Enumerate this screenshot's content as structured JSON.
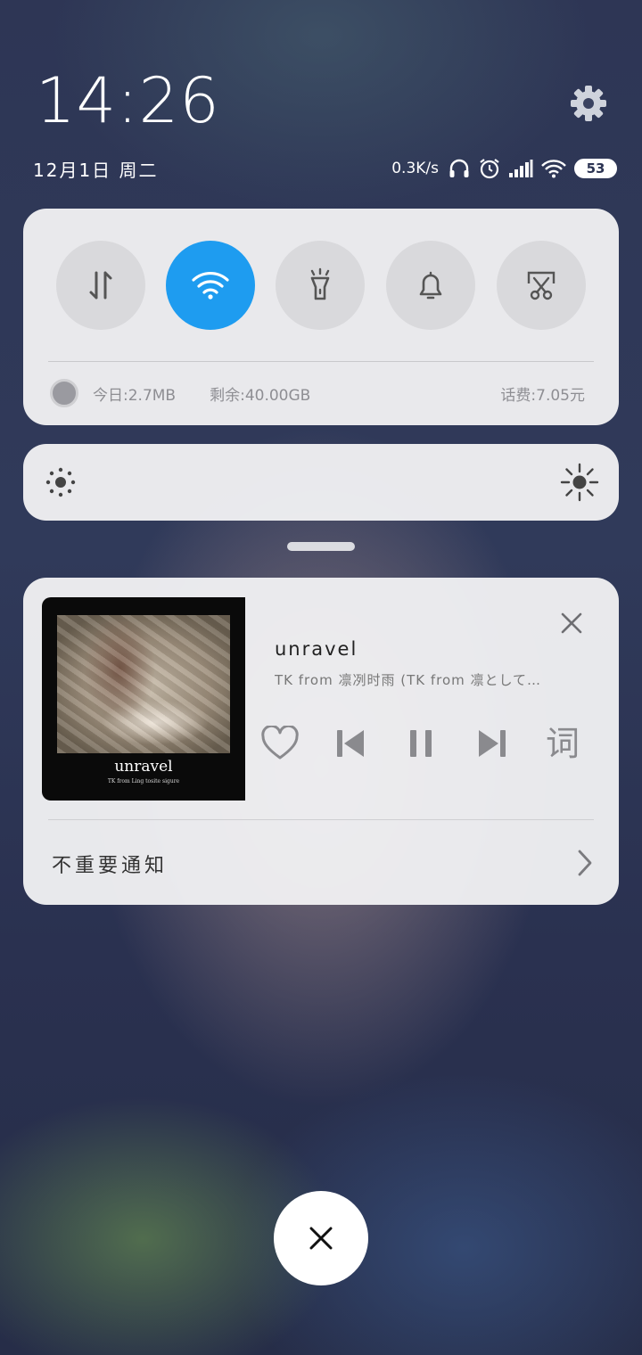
{
  "status": {
    "time": "14:26",
    "date": "12月1日 周二",
    "net_speed": "0.3K/s",
    "battery": "53",
    "icons": [
      "headphones-icon",
      "alarm-icon",
      "signal-icon",
      "wifi-icon",
      "battery-icon"
    ]
  },
  "quick_settings": {
    "toggles": [
      {
        "name": "mobile-data",
        "icon": "data-arrows-icon",
        "active": false
      },
      {
        "name": "wifi",
        "icon": "wifi-icon",
        "active": true
      },
      {
        "name": "flashlight",
        "icon": "flashlight-icon",
        "active": false
      },
      {
        "name": "sound",
        "icon": "bell-icon",
        "active": false
      },
      {
        "name": "screenshot",
        "icon": "scissors-icon",
        "active": false
      }
    ],
    "data_today": "今日:2.7MB",
    "data_remaining": "剩余:40.00GB",
    "phone_fee": "话费:7.05元"
  },
  "music": {
    "album_title": "unravel",
    "album_subtitle": "TK from Ling tosite sigure",
    "title": "unravel",
    "artist": "TK from 凛冽时雨 (TK from 凛として…",
    "lyrics_label": "词"
  },
  "notifications": {
    "unimportant_label": "不重要通知"
  },
  "colors": {
    "accent": "#1e9cf0",
    "card": "#f0f0f2"
  }
}
